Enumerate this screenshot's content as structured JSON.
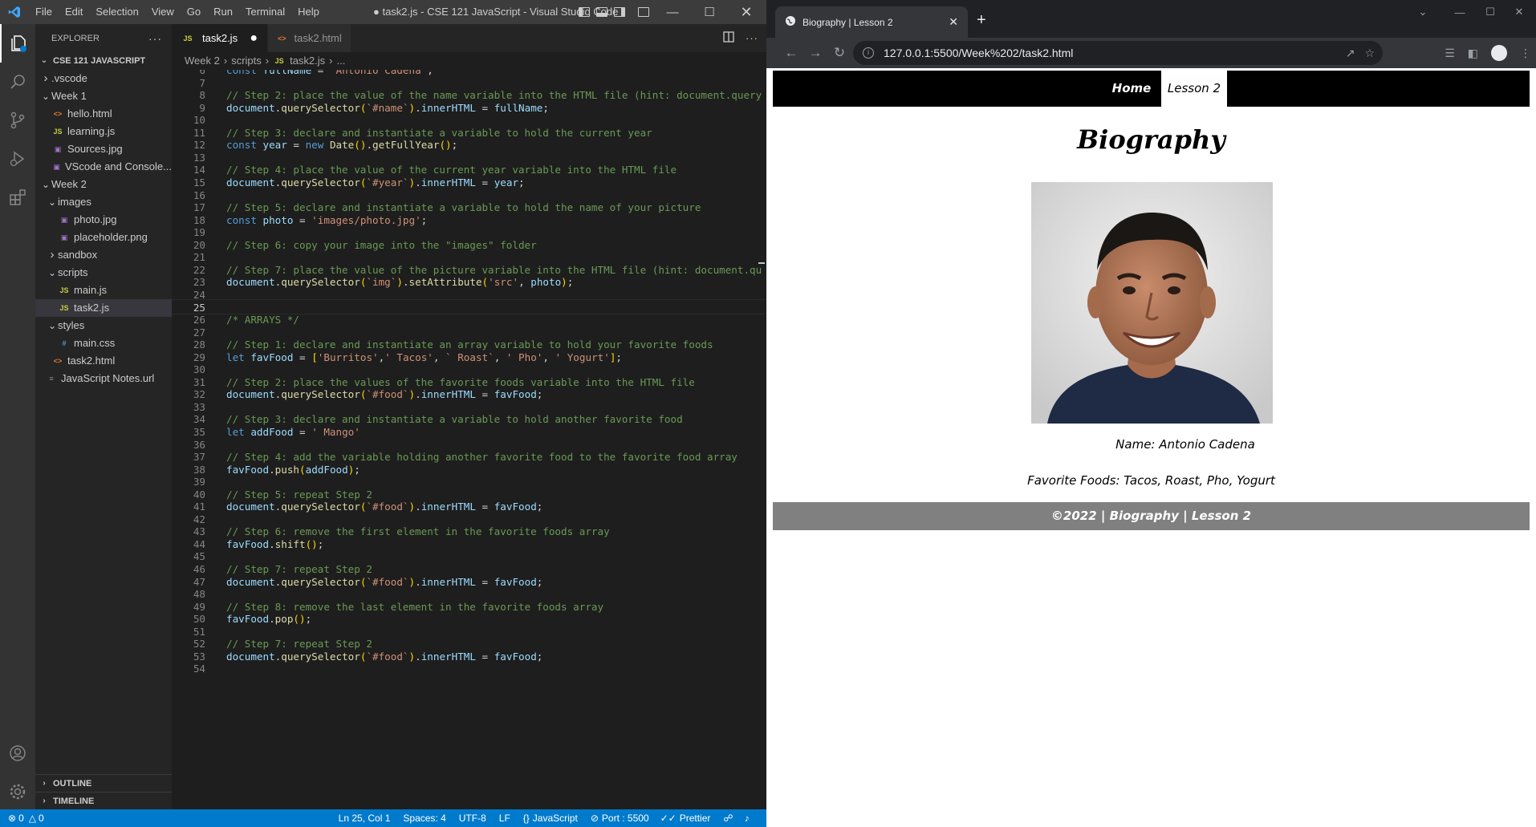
{
  "vscode": {
    "menu": [
      "File",
      "Edit",
      "Selection",
      "View",
      "Go",
      "Run",
      "Terminal",
      "Help"
    ],
    "window_title": "● task2.js - CSE 121 JavaScript - Visual Studio Code",
    "explorer": {
      "header": "EXPLORER",
      "root": "CSE 121 JAVASCRIPT",
      "tree": [
        {
          "label": ".vscode",
          "kind": "folder",
          "open": false,
          "depth": 1
        },
        {
          "label": "Week 1",
          "kind": "folder",
          "open": true,
          "depth": 1
        },
        {
          "label": "hello.html",
          "kind": "html",
          "depth": 2
        },
        {
          "label": "learning.js",
          "kind": "js",
          "depth": 2
        },
        {
          "label": "Sources.jpg",
          "kind": "img",
          "depth": 2
        },
        {
          "label": "VScode and Console...",
          "kind": "img",
          "depth": 2
        },
        {
          "label": "Week 2",
          "kind": "folder",
          "open": true,
          "depth": 1
        },
        {
          "label": "images",
          "kind": "folder",
          "open": true,
          "depth": 2
        },
        {
          "label": "photo.jpg",
          "kind": "img",
          "depth": 3
        },
        {
          "label": "placeholder.png",
          "kind": "img",
          "depth": 3
        },
        {
          "label": "sandbox",
          "kind": "folder",
          "open": false,
          "depth": 2
        },
        {
          "label": "scripts",
          "kind": "folder",
          "open": true,
          "depth": 2
        },
        {
          "label": "main.js",
          "kind": "js",
          "depth": 3
        },
        {
          "label": "task2.js",
          "kind": "js",
          "depth": 3,
          "selected": true
        },
        {
          "label": "styles",
          "kind": "folder",
          "open": true,
          "depth": 2
        },
        {
          "label": "main.css",
          "kind": "css",
          "depth": 3
        },
        {
          "label": "task2.html",
          "kind": "html",
          "depth": 2
        },
        {
          "label": "JavaScript Notes.url",
          "kind": "url",
          "depth": 1
        }
      ],
      "outline": "OUTLINE",
      "timeline": "TIMELINE"
    },
    "tabs": {
      "active": "task2.js",
      "inactive": "task2.html"
    },
    "breadcrumb": [
      "Week 2",
      "scripts",
      "task2.js",
      "..."
    ],
    "current_line": 25,
    "code": [
      {
        "n": 6,
        "t": [
          [
            "const ",
            "k"
          ],
          [
            "fullName ",
            "v"
          ],
          [
            "= ",
            "d"
          ],
          [
            "`Antonio Cadena`",
            "s"
          ],
          [
            ";",
            "d"
          ]
        ]
      },
      {
        "n": 7,
        "t": []
      },
      {
        "n": 8,
        "t": [
          [
            "// Step 2: place the value of the name variable into the HTML file (hint: document.query",
            "c"
          ]
        ]
      },
      {
        "n": 9,
        "t": [
          [
            "document",
            "v"
          ],
          [
            ".",
            "d"
          ],
          [
            "querySelector",
            "f"
          ],
          [
            "(",
            "p"
          ],
          [
            "`#name`",
            "s"
          ],
          [
            ")",
            "p"
          ],
          [
            ".",
            "d"
          ],
          [
            "innerHTML ",
            "v"
          ],
          [
            "= ",
            "d"
          ],
          [
            "fullName",
            "v"
          ],
          [
            ";",
            "d"
          ]
        ]
      },
      {
        "n": 10,
        "t": []
      },
      {
        "n": 11,
        "t": [
          [
            "// Step 3: declare and instantiate a variable to hold the current year",
            "c"
          ]
        ]
      },
      {
        "n": 12,
        "t": [
          [
            "const ",
            "k"
          ],
          [
            "year ",
            "v"
          ],
          [
            "= ",
            "d"
          ],
          [
            "new ",
            "k"
          ],
          [
            "Date",
            "f"
          ],
          [
            "()",
            "p"
          ],
          [
            ".",
            "d"
          ],
          [
            "getFullYear",
            "f"
          ],
          [
            "()",
            "p"
          ],
          [
            ";",
            "d"
          ]
        ]
      },
      {
        "n": 13,
        "t": []
      },
      {
        "n": 14,
        "t": [
          [
            "// Step 4: place the value of the current year variable into the HTML file",
            "c"
          ]
        ]
      },
      {
        "n": 15,
        "t": [
          [
            "document",
            "v"
          ],
          [
            ".",
            "d"
          ],
          [
            "querySelector",
            "f"
          ],
          [
            "(",
            "p"
          ],
          [
            "`#year`",
            "s"
          ],
          [
            ")",
            "p"
          ],
          [
            ".",
            "d"
          ],
          [
            "innerHTML ",
            "v"
          ],
          [
            "= ",
            "d"
          ],
          [
            "year",
            "v"
          ],
          [
            ";",
            "d"
          ]
        ]
      },
      {
        "n": 16,
        "t": []
      },
      {
        "n": 17,
        "t": [
          [
            "// Step 5: declare and instantiate a variable to hold the name of your picture",
            "c"
          ]
        ]
      },
      {
        "n": 18,
        "t": [
          [
            "const ",
            "k"
          ],
          [
            "photo ",
            "v"
          ],
          [
            "= ",
            "d"
          ],
          [
            "'images/photo.jpg'",
            "s"
          ],
          [
            ";",
            "d"
          ]
        ]
      },
      {
        "n": 19,
        "t": []
      },
      {
        "n": 20,
        "t": [
          [
            "// Step 6: copy your image into the \"images\" folder",
            "c"
          ]
        ]
      },
      {
        "n": 21,
        "t": []
      },
      {
        "n": 22,
        "t": [
          [
            "// Step 7: place the value of the picture variable into the HTML file (hint: document.qu",
            "c"
          ]
        ]
      },
      {
        "n": 23,
        "t": [
          [
            "document",
            "v"
          ],
          [
            ".",
            "d"
          ],
          [
            "querySelector",
            "f"
          ],
          [
            "(",
            "p"
          ],
          [
            "`img`",
            "s"
          ],
          [
            ")",
            "p"
          ],
          [
            ".",
            "d"
          ],
          [
            "setAttribute",
            "f"
          ],
          [
            "(",
            "p"
          ],
          [
            "'src'",
            "s"
          ],
          [
            ", ",
            "d"
          ],
          [
            "photo",
            "v"
          ],
          [
            ")",
            "p"
          ],
          [
            ";",
            "d"
          ]
        ]
      },
      {
        "n": 24,
        "t": []
      },
      {
        "n": 25,
        "t": []
      },
      {
        "n": 26,
        "t": [
          [
            "/* ARRAYS */",
            "c"
          ]
        ]
      },
      {
        "n": 27,
        "t": []
      },
      {
        "n": 28,
        "t": [
          [
            "// Step 1: declare and instantiate an array variable to hold your favorite foods",
            "c"
          ]
        ]
      },
      {
        "n": 29,
        "t": [
          [
            "let ",
            "k"
          ],
          [
            "favFood ",
            "v"
          ],
          [
            "= ",
            "d"
          ],
          [
            "[",
            "p"
          ],
          [
            "'Burritos'",
            "s"
          ],
          [
            ",",
            "d"
          ],
          [
            "' Tacos'",
            "s"
          ],
          [
            ", ",
            "d"
          ],
          [
            "` Roast`",
            "s"
          ],
          [
            ", ",
            "d"
          ],
          [
            "' Pho'",
            "s"
          ],
          [
            ", ",
            "d"
          ],
          [
            "' Yogurt'",
            "s"
          ],
          [
            "]",
            "p"
          ],
          [
            ";",
            "d"
          ]
        ]
      },
      {
        "n": 30,
        "t": []
      },
      {
        "n": 31,
        "t": [
          [
            "// Step 2: place the values of the favorite foods variable into the HTML file",
            "c"
          ]
        ]
      },
      {
        "n": 32,
        "t": [
          [
            "document",
            "v"
          ],
          [
            ".",
            "d"
          ],
          [
            "querySelector",
            "f"
          ],
          [
            "(",
            "p"
          ],
          [
            "`#food`",
            "s"
          ],
          [
            ")",
            "p"
          ],
          [
            ".",
            "d"
          ],
          [
            "innerHTML ",
            "v"
          ],
          [
            "= ",
            "d"
          ],
          [
            "favFood",
            "v"
          ],
          [
            ";",
            "d"
          ]
        ]
      },
      {
        "n": 33,
        "t": []
      },
      {
        "n": 34,
        "t": [
          [
            "// Step 3: declare and instantiate a variable to hold another favorite food",
            "c"
          ]
        ]
      },
      {
        "n": 35,
        "t": [
          [
            "let ",
            "k"
          ],
          [
            "addFood ",
            "v"
          ],
          [
            "= ",
            "d"
          ],
          [
            "' Mango'",
            "s"
          ]
        ]
      },
      {
        "n": 36,
        "t": []
      },
      {
        "n": 37,
        "t": [
          [
            "// Step 4: add the variable holding another favorite food to the favorite food array",
            "c"
          ]
        ]
      },
      {
        "n": 38,
        "t": [
          [
            "favFood",
            "v"
          ],
          [
            ".",
            "d"
          ],
          [
            "push",
            "f"
          ],
          [
            "(",
            "p"
          ],
          [
            "addFood",
            "v"
          ],
          [
            ")",
            "p"
          ],
          [
            ";",
            "d"
          ]
        ]
      },
      {
        "n": 39,
        "t": []
      },
      {
        "n": 40,
        "t": [
          [
            "// Step 5: repeat Step 2",
            "c"
          ]
        ]
      },
      {
        "n": 41,
        "t": [
          [
            "document",
            "v"
          ],
          [
            ".",
            "d"
          ],
          [
            "querySelector",
            "f"
          ],
          [
            "(",
            "p"
          ],
          [
            "`#food`",
            "s"
          ],
          [
            ")",
            "p"
          ],
          [
            ".",
            "d"
          ],
          [
            "innerHTML ",
            "v"
          ],
          [
            "= ",
            "d"
          ],
          [
            "favFood",
            "v"
          ],
          [
            ";",
            "d"
          ]
        ]
      },
      {
        "n": 42,
        "t": []
      },
      {
        "n": 43,
        "t": [
          [
            "// Step 6: remove the first element in the favorite foods array",
            "c"
          ]
        ]
      },
      {
        "n": 44,
        "t": [
          [
            "favFood",
            "v"
          ],
          [
            ".",
            "d"
          ],
          [
            "shift",
            "f"
          ],
          [
            "()",
            "p"
          ],
          [
            ";",
            "d"
          ]
        ]
      },
      {
        "n": 45,
        "t": []
      },
      {
        "n": 46,
        "t": [
          [
            "// Step 7: repeat Step 2",
            "c"
          ]
        ]
      },
      {
        "n": 47,
        "t": [
          [
            "document",
            "v"
          ],
          [
            ".",
            "d"
          ],
          [
            "querySelector",
            "f"
          ],
          [
            "(",
            "p"
          ],
          [
            "`#food`",
            "s"
          ],
          [
            ")",
            "p"
          ],
          [
            ".",
            "d"
          ],
          [
            "innerHTML ",
            "v"
          ],
          [
            "= ",
            "d"
          ],
          [
            "favFood",
            "v"
          ],
          [
            ";",
            "d"
          ]
        ]
      },
      {
        "n": 48,
        "t": []
      },
      {
        "n": 49,
        "t": [
          [
            "// Step 8: remove the last element in the favorite foods array",
            "c"
          ]
        ]
      },
      {
        "n": 50,
        "t": [
          [
            "favFood",
            "v"
          ],
          [
            ".",
            "d"
          ],
          [
            "pop",
            "f"
          ],
          [
            "()",
            "p"
          ],
          [
            ";",
            "d"
          ]
        ]
      },
      {
        "n": 51,
        "t": []
      },
      {
        "n": 52,
        "t": [
          [
            "// Step 7: repeat Step 2",
            "c"
          ]
        ]
      },
      {
        "n": 53,
        "t": [
          [
            "document",
            "v"
          ],
          [
            ".",
            "d"
          ],
          [
            "querySelector",
            "f"
          ],
          [
            "(",
            "p"
          ],
          [
            "`#food`",
            "s"
          ],
          [
            ")",
            "p"
          ],
          [
            ".",
            "d"
          ],
          [
            "innerHTML ",
            "v"
          ],
          [
            "= ",
            "d"
          ],
          [
            "favFood",
            "v"
          ],
          [
            ";",
            "d"
          ]
        ]
      },
      {
        "n": 54,
        "t": []
      }
    ],
    "status": {
      "errors": "0",
      "warnings": "0",
      "position": "Ln 25, Col 1",
      "spaces": "Spaces: 4",
      "encoding": "UTF-8",
      "eol": "LF",
      "language": "JavaScript",
      "port": "Port : 5500",
      "prettier": "Prettier"
    },
    "colors": {
      "statusbar": "#007acc",
      "activitybar": "#333333",
      "sidebar": "#252526",
      "editor": "#1e1e1e"
    }
  },
  "browser": {
    "tab_title": "Biography | Lesson 2",
    "url": "127.0.0.1:5500/Week%202/task2.html",
    "page": {
      "nav_home": "Home",
      "nav_lesson": "Lesson 2",
      "heading": "Biography",
      "name_line": "Name: Antonio Cadena",
      "food_line": "Favorite Foods: Tacos, Roast, Pho, Yogurt",
      "footer": "©2022 | Biography | Lesson 2"
    }
  }
}
